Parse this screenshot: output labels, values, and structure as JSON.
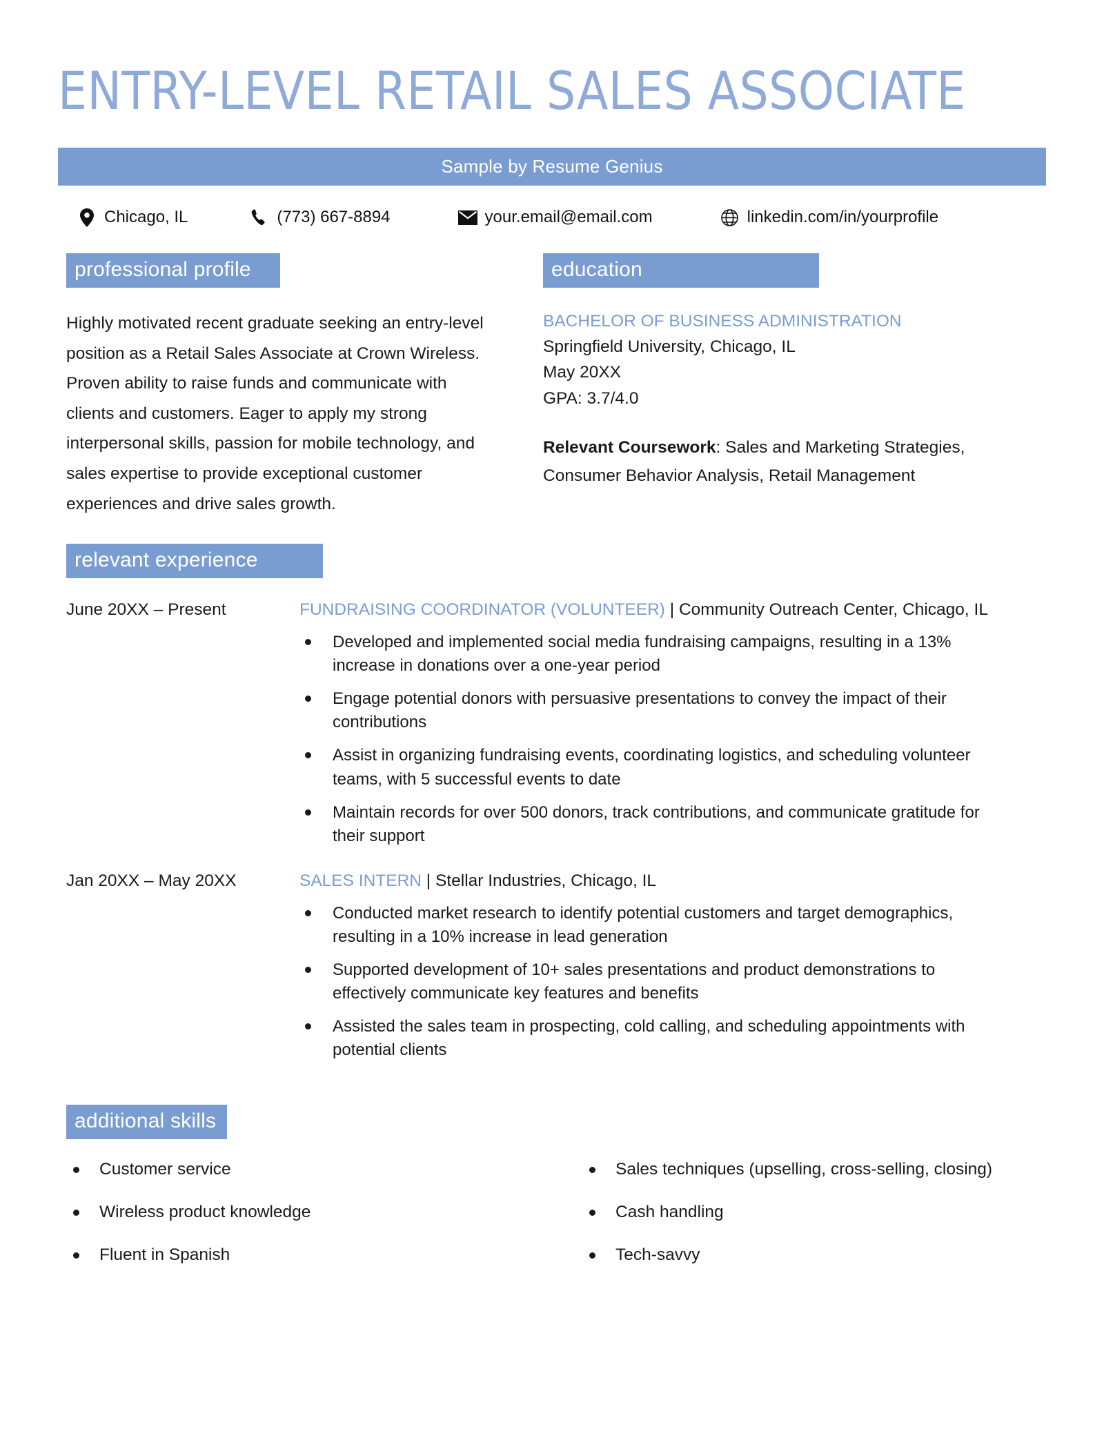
{
  "header": {
    "name_title": "ENTRY-LEVEL RETAIL SALES ASSOCIATE",
    "subtitle": "Sample by Resume Genius"
  },
  "contact": {
    "location": "Chicago, IL",
    "phone": "(773) 667-8894",
    "email": "your.email@email.com",
    "linkedin": "linkedin.com/in/yourprofile",
    "icons": {
      "location": "map-pin-icon",
      "phone": "phone-icon",
      "email": "envelope-icon",
      "linkedin": "globe-icon"
    }
  },
  "sections": {
    "profile_heading": "professional profile",
    "education_heading": "education",
    "experience_heading": "relevant experience",
    "skills_heading": "additional skills"
  },
  "profile": {
    "summary": "Highly motivated recent graduate seeking an entry-level position as a Retail Sales Associate at Crown Wireless. Proven ability to raise funds and communicate with clients and customers. Eager to apply my strong interpersonal skills, passion for mobile technology, and sales expertise to provide exceptional customer experiences and drive sales growth."
  },
  "education": {
    "degree": "BACHELOR OF BUSINESS ADMINISTRATION",
    "school": "Springfield University, Chicago, IL",
    "date": "May 20XX",
    "gpa": "GPA: 3.7/4.0",
    "coursework_label": "Relevant Coursework",
    "coursework_value": ": Sales and Marketing Strategies, Consumer Behavior Analysis, Retail Management"
  },
  "experience": [
    {
      "dates": "June 20XX – Present",
      "title": "FUNDRAISING COORDINATOR (VOLUNTEER)",
      "separator": " | ",
      "company": "Community Outreach Center, Chicago, IL",
      "bullets": [
        "Developed and implemented social media fundraising campaigns, resulting in a 13% increase in donations over a one-year period",
        "Engage potential donors with persuasive presentations to convey the impact of their contributions",
        "Assist in organizing fundraising events, coordinating logistics, and scheduling volunteer teams, with 5 successful events to date",
        "Maintain records for over 500 donors, track contributions, and communicate gratitude for their support"
      ]
    },
    {
      "dates": "Jan 20XX – May 20XX",
      "title": "SALES INTERN",
      "separator": " | ",
      "company": "Stellar Industries, Chicago, IL",
      "bullets": [
        "Conducted market research to identify potential customers and target demographics, resulting in a 10% increase in lead generation",
        "Supported development of 10+ sales presentations and product demonstrations to effectively communicate key features and benefits",
        "Assisted the sales team in prospecting, cold calling, and scheduling appointments with potential clients"
      ]
    }
  ],
  "skills": {
    "left": [
      "Customer service",
      "Wireless product knowledge",
      "Fluent in Spanish"
    ],
    "right": [
      "Sales techniques (upselling, cross-selling, closing)",
      "Cash handling",
      "Tech-savvy"
    ]
  },
  "colors": {
    "accent_blue": "#7a9dd1",
    "title_blue": "#8fa9d8",
    "text_black": "#1a1a1a",
    "background": "#ffffff"
  }
}
